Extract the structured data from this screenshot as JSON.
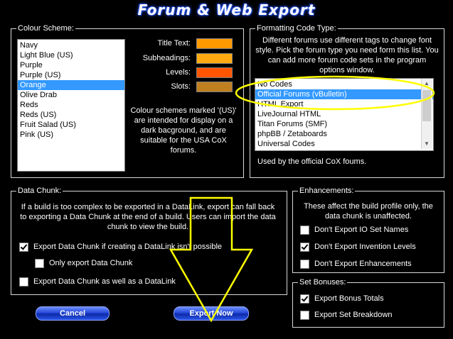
{
  "window": {
    "title": "Forum & Web Export"
  },
  "colour_scheme": {
    "label": "Colour Scheme:",
    "items": [
      "Navy",
      "Light Blue (US)",
      "Purple",
      "Purple (US)",
      "Orange",
      "Olive Drab",
      "Reds",
      "Reds (US)",
      "Fruit Salad (US)",
      "Pink (US)"
    ],
    "selected": "Orange",
    "swatches": [
      {
        "label": "Title Text:",
        "color": "#ff9900"
      },
      {
        "label": "Subheadings:",
        "color": "#ffaa11"
      },
      {
        "label": "Levels:",
        "color": "#ff5500"
      },
      {
        "label": "Slots:",
        "color": "#c08020"
      }
    ],
    "note": "Colour schemes marked '(US)' are intended for display on a dark bacground, and are suitable for the USA CoX forums."
  },
  "formatting": {
    "label": "Formatting Code Type:",
    "description": "Different forums use different tags to change font style. Pick the forum type you need form this list. You can add more forum code sets in the program options window.",
    "items": [
      "No Codes",
      "Official Forums (vBulletin)",
      "HTML Export",
      "LiveJournal HTML",
      "Titan Forums (SMF)",
      "phpBB / Zetaboards",
      "Universal Codes"
    ],
    "selected": "Official Forums (vBulletin)",
    "note": "Used by the official CoX foums."
  },
  "data_chunk": {
    "label": "Data Chunk:",
    "description": "If a build is too complex to be exported in a DataLink, export can fall back to exporting a Data Chunk at the end of a build. Users can import the data chunk to view the build.",
    "options": [
      {
        "label": "Export Data Chunk if creating a DataLink isn't possible",
        "checked": true
      },
      {
        "label": "Only export Data Chunk",
        "checked": false
      },
      {
        "label": "Export Data Chunk as well as a DataLink",
        "checked": false
      }
    ]
  },
  "enhancements": {
    "label": "Enhancements:",
    "description": "These affect the build profile only, the data chunk is unaffected.",
    "options": [
      {
        "label": "Don't Export IO Set Names",
        "checked": false
      },
      {
        "label": "Don't Export Invention Levels",
        "checked": true
      },
      {
        "label": "Don't Export Enhancements",
        "checked": false
      }
    ]
  },
  "set_bonuses": {
    "label": "Set Bonuses:",
    "options": [
      {
        "label": "Export Bonus Totals",
        "checked": true
      },
      {
        "label": "Export Set Breakdown",
        "checked": false
      }
    ]
  },
  "buttons": {
    "cancel": "Cancel",
    "export": "Export Now"
  }
}
